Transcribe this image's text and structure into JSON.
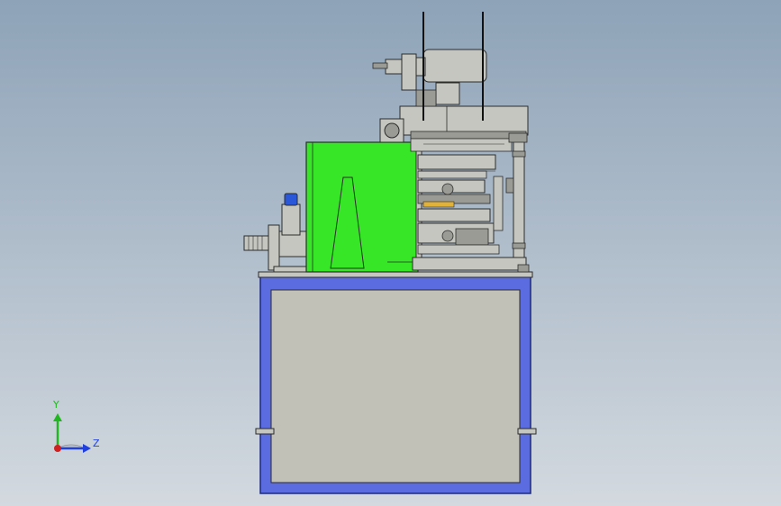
{
  "viewport": {
    "background_top": "#8ea3b8",
    "background_bottom": "#d3d9df",
    "view_orientation": "right"
  },
  "colors": {
    "base_frame": "#5b6be0",
    "base_frame_edge": "#1e2a7a",
    "panel": "#c2c1b8",
    "machine_gray": "#c6c6c0",
    "machine_dark": "#9b9b95",
    "edge": "#2c2c2c",
    "green_cover": "#37e627",
    "knob_blue": "#2a56d8"
  },
  "triad": {
    "y_label": "Y",
    "z_label": "Z",
    "y_color": "#22b622",
    "z_color": "#2040e0",
    "x_color": "#d02020"
  }
}
